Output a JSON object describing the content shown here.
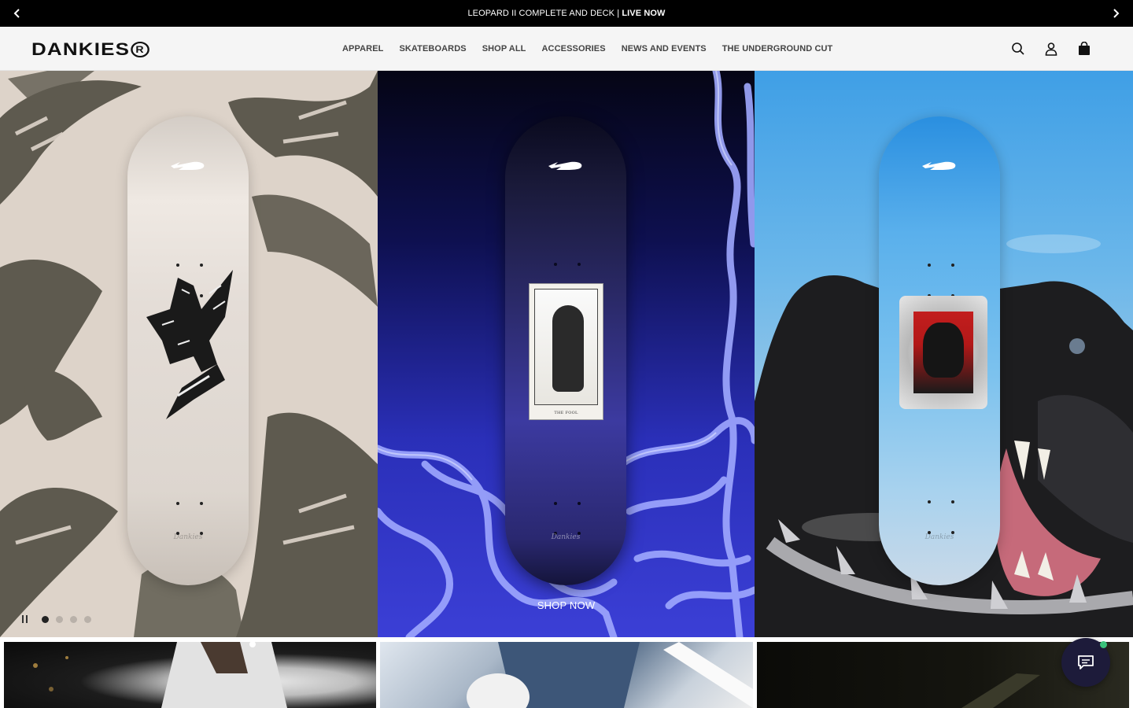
{
  "announcement": {
    "text": "LEOPARD II COMPLETE AND DECK | ",
    "highlight": "LIVE NOW",
    "prev_icon": "chevron-left-icon",
    "next_icon": "chevron-right-icon"
  },
  "header": {
    "logo": "DANKIES",
    "logo_mark": "R",
    "nav": [
      "APPAREL",
      "SKATEBOARDS",
      "SHOP ALL",
      "ACCESSORIES",
      "NEWS AND EVENTS",
      "THE UNDERGROUND CUT"
    ],
    "icons": [
      "search-icon",
      "account-icon",
      "cart-icon"
    ]
  },
  "hero": {
    "panels": [
      {
        "name": "falcon-deck",
        "signature": "Dankies"
      },
      {
        "name": "the-fool-deck",
        "signature": "Dankies",
        "card_label": "THE FOOL"
      },
      {
        "name": "panther-deck",
        "signature": "Dankies"
      }
    ],
    "cta": "SHOP NOW",
    "slides_count": 4,
    "active_slide": 1
  },
  "colors": {
    "announcement_bg": "#000000",
    "header_bg": "#f5f5f5",
    "panel1_bg": "#ddd3c9",
    "chat_bg": "#1d1b3a"
  }
}
